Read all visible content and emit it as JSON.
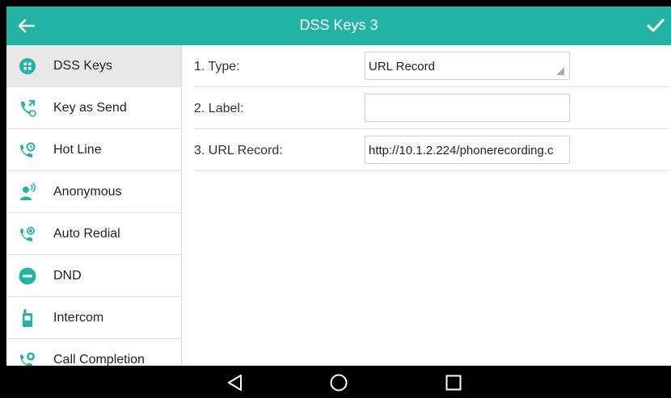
{
  "header": {
    "title": "DSS Keys 3",
    "back_icon": "back-arrow-icon",
    "confirm_icon": "checkmark-icon",
    "color": "#22b3a5"
  },
  "sidebar": {
    "items": [
      {
        "label": "DSS Keys",
        "icon": "grid-icon",
        "active": true
      },
      {
        "label": "Key as Send",
        "icon": "phone-key-icon"
      },
      {
        "label": "Hot Line",
        "icon": "phone-hotline-icon"
      },
      {
        "label": "Anonymous",
        "icon": "anonymous-user-icon"
      },
      {
        "label": "Auto Redial",
        "icon": "phone-redial-icon"
      },
      {
        "label": "DND",
        "icon": "dnd-icon"
      },
      {
        "label": "Intercom",
        "icon": "intercom-icon"
      },
      {
        "label": "Call Completion",
        "icon": "phone-completion-icon"
      }
    ]
  },
  "form": {
    "rows": [
      {
        "label": "1. Type:",
        "value": "URL Record",
        "kind": "combo"
      },
      {
        "label": "2. Label:",
        "value": "",
        "kind": "text"
      },
      {
        "label": "3. URL Record:",
        "value": "http://10.1.2.224/phonerecording.c",
        "kind": "text"
      }
    ]
  },
  "navbar": {
    "back_icon": "nav-back-icon",
    "home_icon": "nav-home-icon",
    "recents_icon": "nav-recents-icon"
  }
}
